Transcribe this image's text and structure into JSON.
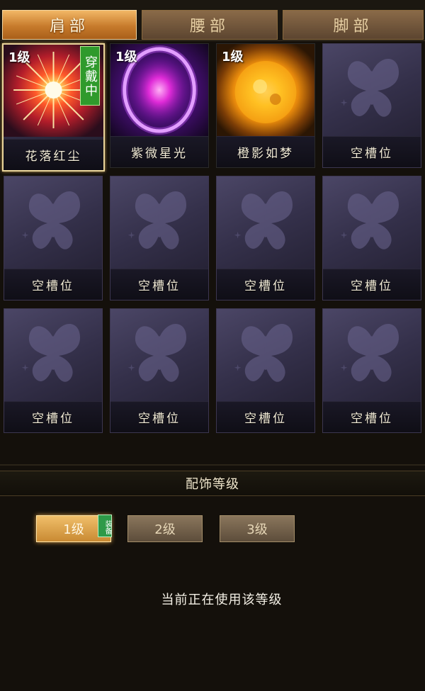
{
  "tabs": [
    {
      "label": "肩部",
      "active": true
    },
    {
      "label": "腰部",
      "active": false
    },
    {
      "label": "脚部",
      "active": false
    }
  ],
  "slots": [
    {
      "name": "花落红尘",
      "level": "1级",
      "badge": "穿戴中",
      "type": "red-starburst",
      "selected": true
    },
    {
      "name": "紫微星光",
      "level": "1级",
      "type": "purple-orb"
    },
    {
      "name": "橙影如梦",
      "level": "1级",
      "type": "orange-sun"
    },
    {
      "name": "空槽位",
      "type": "empty"
    },
    {
      "name": "空槽位",
      "type": "empty"
    },
    {
      "name": "空槽位",
      "type": "empty"
    },
    {
      "name": "空槽位",
      "type": "empty"
    },
    {
      "name": "空槽位",
      "type": "empty"
    },
    {
      "name": "空槽位",
      "type": "empty"
    },
    {
      "name": "空槽位",
      "type": "empty"
    },
    {
      "name": "空槽位",
      "type": "empty"
    },
    {
      "name": "空槽位",
      "type": "empty"
    }
  ],
  "level_section": {
    "title": "配饰等级",
    "levels": [
      {
        "label": "1级",
        "active": true,
        "tag": "装备"
      },
      {
        "label": "2级",
        "active": false
      },
      {
        "label": "3级",
        "active": false
      }
    ],
    "status": "当前正在使用该等级"
  },
  "colors": {
    "background": "#14100b",
    "tab_active": "#c77b2c",
    "badge_green": "#2f9a2c"
  }
}
